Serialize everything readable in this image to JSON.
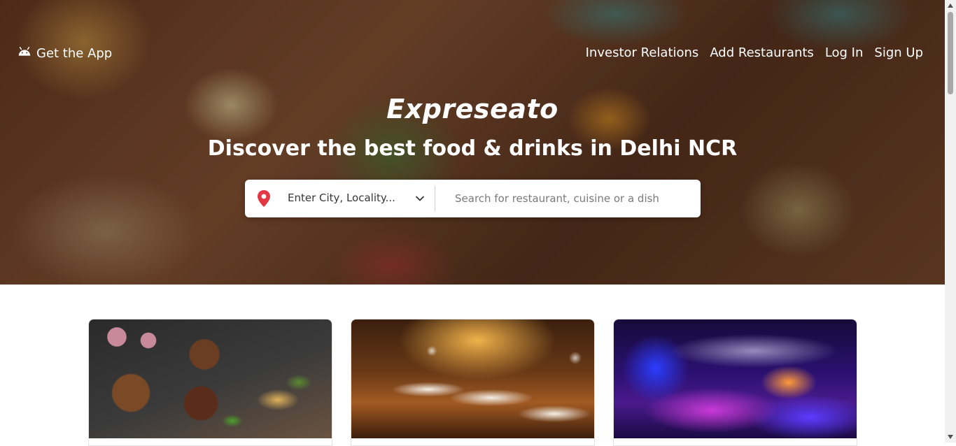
{
  "header": {
    "get_app_label": "Get the App",
    "get_app_icon": "android-icon",
    "nav": [
      {
        "label": "Investor Relations"
      },
      {
        "label": "Add Restaurants"
      },
      {
        "label": "Log In"
      },
      {
        "label": "Sign Up"
      }
    ]
  },
  "hero": {
    "brand": "Expreseato",
    "tagline": "Discover the best food & drinks in Delhi NCR"
  },
  "search": {
    "location_icon": "location-pin-icon",
    "location_value": "Enter City, Locality...",
    "location_dropdown_icon": "chevron-down-icon",
    "query_placeholder": "Search for restaurant, cuisine or a dish",
    "query_value": ""
  },
  "cards": [
    {
      "image": "food-spread-image"
    },
    {
      "image": "fine-dining-image"
    },
    {
      "image": "nightlife-club-image"
    }
  ],
  "colors": {
    "pin": "#e23744",
    "hero_text": "#ffffff",
    "input_text": "#363636",
    "placeholder": "#7a7a7a"
  }
}
